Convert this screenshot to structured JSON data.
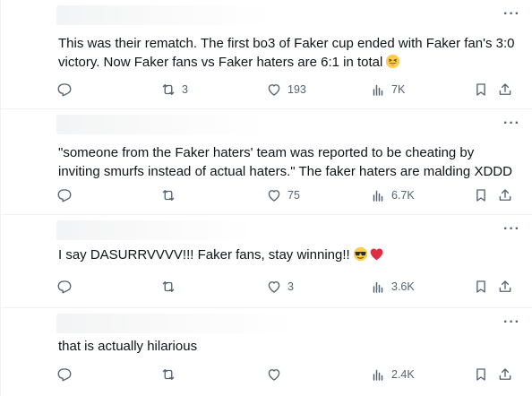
{
  "tweets": [
    {
      "text": "This was their rematch. The first bo3 of Faker cup ended with Faker fan's 3:0 victory. Now Faker fans vs Faker haters are 6:1 in total",
      "emoji": "grinning-squinting-face",
      "replies": "",
      "reposts": "3",
      "likes": "193",
      "views": "7K"
    },
    {
      "text": "\"someone from the Faker haters' team was reported to be cheating by inviting smurfs instead of actual haters.\" The faker haters are malding XDDD",
      "replies": "",
      "reposts": "",
      "likes": "75",
      "views": "6.7K"
    },
    {
      "text": "I say DASURRVVVV!!! Faker fans, stay winning!!",
      "emoji": "sunglasses-and-red-heart",
      "replies": "",
      "reposts": "",
      "likes": "3",
      "views": "3.6K"
    },
    {
      "text": "that is actually hilarious",
      "replies": "",
      "reposts": "",
      "likes": "",
      "views": "2.4K"
    }
  ],
  "colors": {
    "icon": "#536471",
    "text": "#0f1419",
    "divider": "#eff3f4",
    "emoji_face": "#ffcc4d",
    "heart": "#dd2e44"
  }
}
